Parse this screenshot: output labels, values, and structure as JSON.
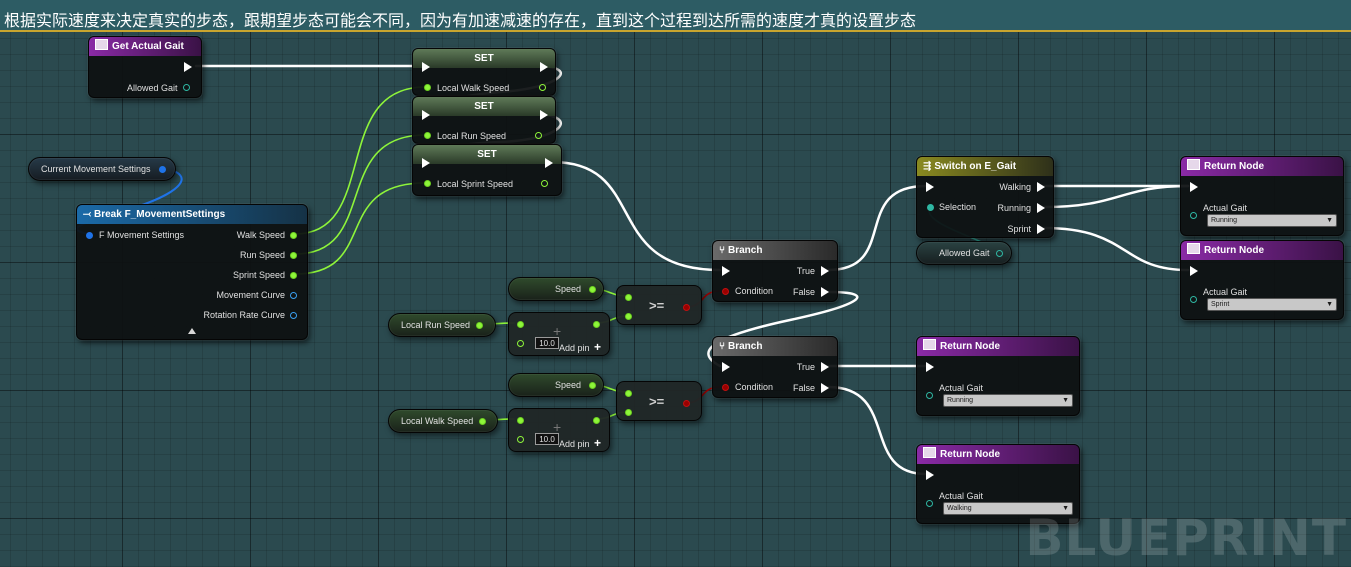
{
  "caption": "根据实际速度来决定真实的步态，跟期望步态可能会不同，因为有加速减速的存在，直到这个过程到达所需的速度才真的设置步态",
  "watermark": "BLUEPRINT",
  "nodes": {
    "get_actual_gait": {
      "title": "Get Actual Gait",
      "output": "Allowed Gait"
    },
    "set_walk": {
      "title": "SET",
      "pin": "Local Walk Speed"
    },
    "set_run": {
      "title": "SET",
      "pin": "Local Run Speed"
    },
    "set_sprint": {
      "title": "SET",
      "pin": "Local Sprint Speed"
    },
    "current_movement_settings": {
      "label": "Current Movement Settings"
    },
    "break_settings": {
      "title": "Break F_MovementSettings",
      "input": "F Movement Settings",
      "outputs": [
        "Walk Speed",
        "Run Speed",
        "Sprint Speed",
        "Movement Curve",
        "Rotation Rate Curve"
      ]
    },
    "switch": {
      "title": "Switch on E_Gait",
      "input": "Selection",
      "outputs": [
        "Walking",
        "Running",
        "Sprint"
      ]
    },
    "allowed_gait_var": {
      "label": "Allowed Gait"
    },
    "branch1": {
      "title": "Branch",
      "condition": "Condition",
      "true": "True",
      "false": "False"
    },
    "branch2": {
      "title": "Branch",
      "condition": "Condition",
      "true": "True",
      "false": "False"
    },
    "speed1": {
      "label": "Speed"
    },
    "speed2": {
      "label": "Speed"
    },
    "local_run_speed": {
      "label": "Local Run Speed"
    },
    "local_walk_speed": {
      "label": "Local Walk Speed"
    },
    "compare1": {
      "op": ">="
    },
    "compare2": {
      "op": ">="
    },
    "add1": {
      "value": "10.0",
      "add_pin": "Add pin"
    },
    "add2": {
      "value": "10.0",
      "add_pin": "Add pin"
    },
    "return1": {
      "title": "Return Node",
      "pin": "Actual Gait",
      "value": "Running"
    },
    "return2": {
      "title": "Return Node",
      "pin": "Actual Gait",
      "value": "Sprint"
    },
    "return3": {
      "title": "Return Node",
      "pin": "Actual Gait",
      "value": "Running"
    },
    "return4": {
      "title": "Return Node",
      "pin": "Actual Gait",
      "value": "Walking"
    }
  },
  "colors": {
    "exec_wire": "#ffffff",
    "float_wire": "#8ef53a",
    "struct_wire": "#1f73e8",
    "bool_wire": "#9a0000",
    "function_header": "#8a2aa6",
    "break_header": "#1b6aa8",
    "switch_header": "#8a8a20"
  }
}
